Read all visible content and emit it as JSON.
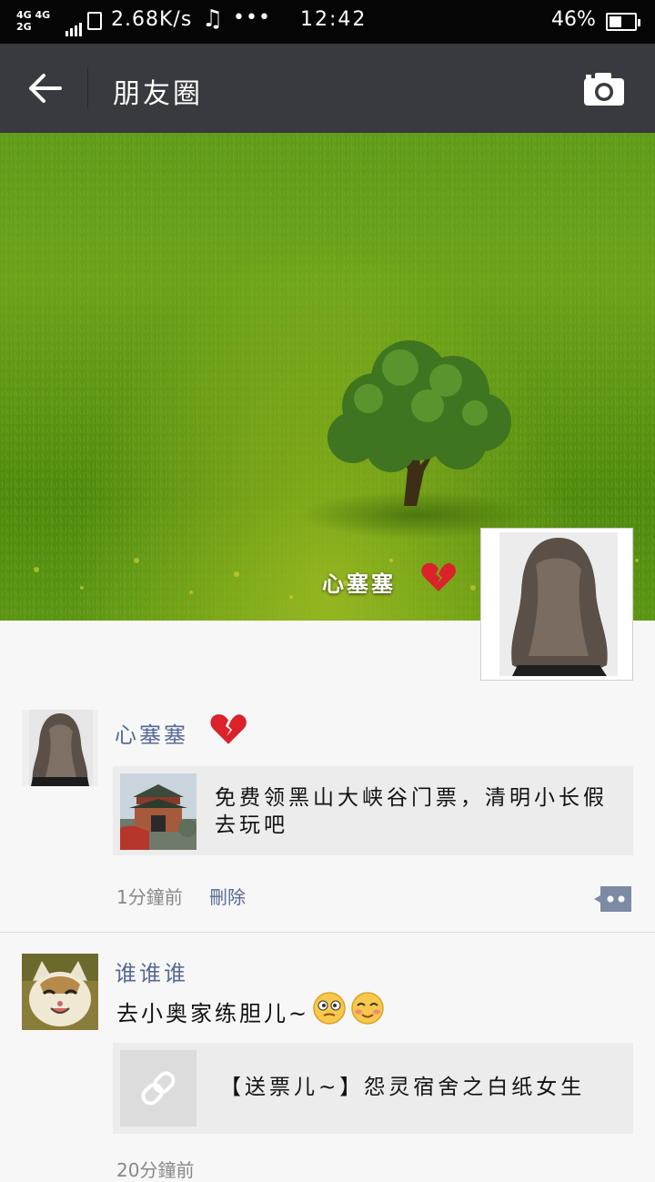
{
  "status_bar": {
    "network_top": "4G 4G",
    "network_bottom": "2G",
    "speed": "2.68K/s",
    "music_icon": "♫",
    "more": "•••",
    "time": "12:42",
    "battery": "46%"
  },
  "nav": {
    "back_icon": "arrow-left-icon",
    "title": "朋友圈",
    "camera_icon": "camera-icon"
  },
  "cover": {
    "name": "心塞塞",
    "emoji_icon": "broken-heart-icon"
  },
  "posts": [
    {
      "author": "心塞塞",
      "author_emoji": "broken-heart-icon",
      "share_text": "免费领黑山大峡谷门票，清明小长假去玩吧",
      "time": "1分鐘前",
      "delete_label": "刪除"
    },
    {
      "author": "谁谁谁",
      "body": "去小奥家练胆儿~",
      "share_text": "【送票儿~】怨灵宿舍之白纸女生",
      "link_icon": "link-icon",
      "time": "20分鐘前"
    }
  ],
  "colors": {
    "nav_bg": "#393a3f",
    "author": "#576b95",
    "share_bg": "#ececec",
    "page_bg": "#f7f7f7"
  }
}
